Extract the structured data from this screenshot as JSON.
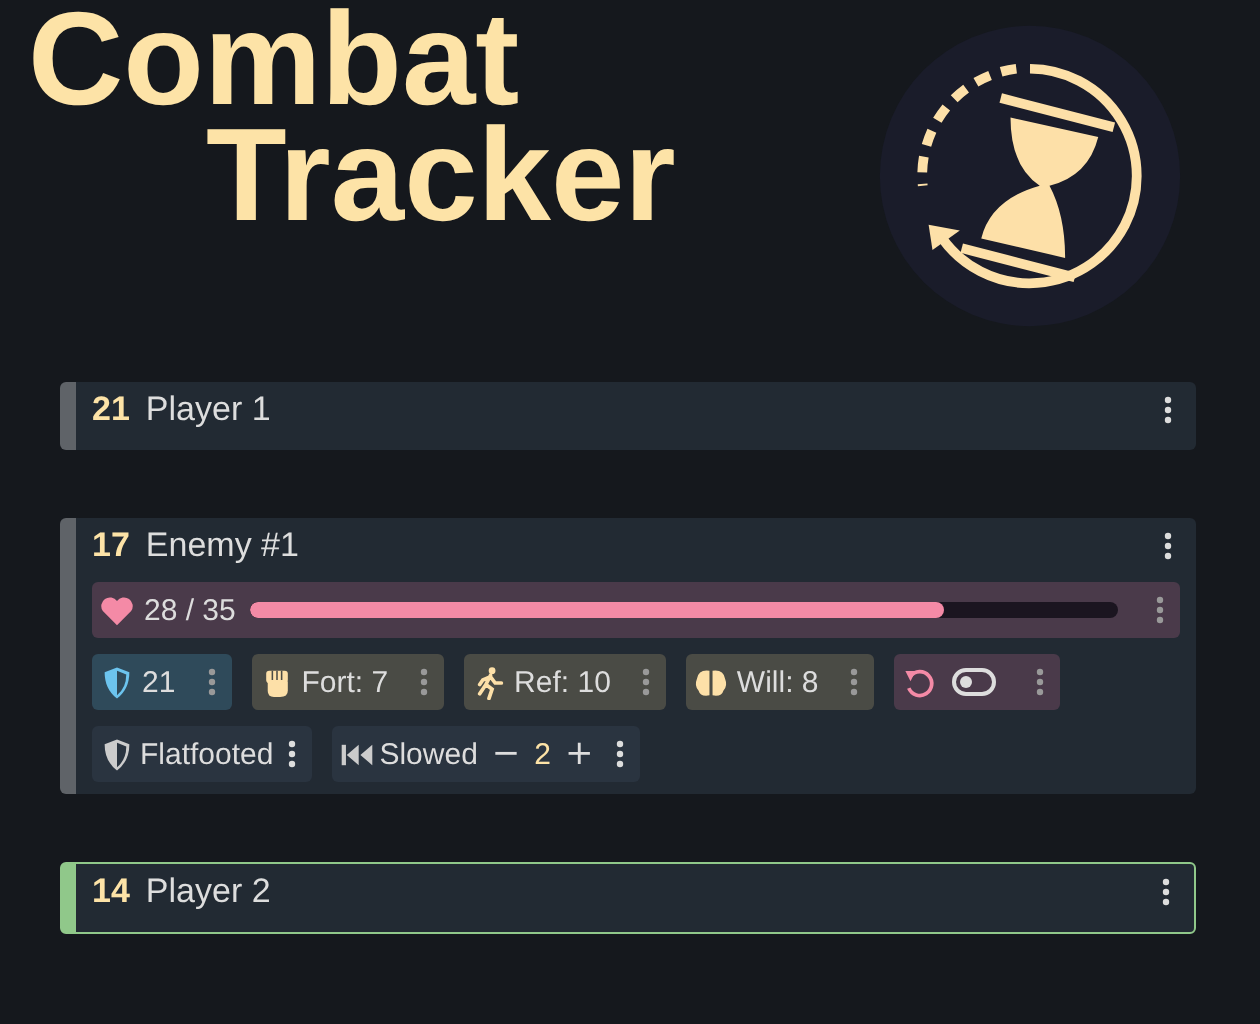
{
  "title": [
    "Combat",
    "Tracker"
  ],
  "combatants": [
    {
      "initiative": "21",
      "name": "Player 1",
      "active": false,
      "expanded": false
    },
    {
      "initiative": "17",
      "name": "Enemy #1",
      "active": false,
      "expanded": true,
      "hp": {
        "text": "28 / 35",
        "level": 0.8
      },
      "stats": [
        {
          "kind": "ac",
          "text": "21"
        },
        {
          "kind": "fort",
          "text": "Fort: 7"
        },
        {
          "kind": "ref",
          "text": "Ref: 10"
        },
        {
          "kind": "will",
          "text": "Will: 8"
        },
        {
          "kind": "toggle",
          "on": false
        }
      ],
      "conditions": [
        {
          "kind": "simple",
          "text": "Flatfooted"
        },
        {
          "kind": "counter",
          "text": "Slowed",
          "minus": "−",
          "value": "2",
          "plus": "+"
        }
      ]
    },
    {
      "initiative": "14",
      "name": "Player 2",
      "active": true,
      "expanded": false
    }
  ]
}
